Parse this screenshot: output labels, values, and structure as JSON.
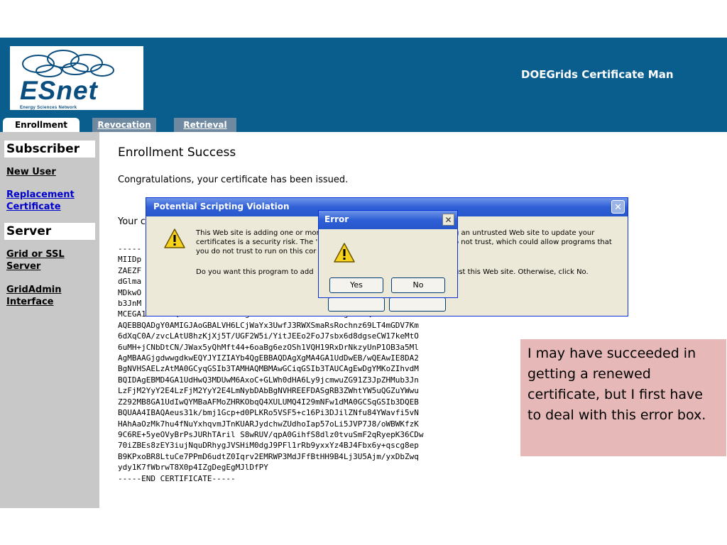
{
  "header": {
    "logo_word": "ESnet",
    "logo_subtitle": "Energy Sciences Network",
    "app_title": "DOEGrids Certificate Man"
  },
  "tabs": [
    {
      "label": "Enrollment"
    },
    {
      "label": "Revocation"
    },
    {
      "label": "Retrieval"
    }
  ],
  "sidebar": {
    "subscriber_heading": "Subscriber",
    "new_user": "New User",
    "replacement_1": "Replacement",
    "replacement_2": "Certificate",
    "server_heading": "Server",
    "grid_ssl_1": "Grid or SSL",
    "grid_ssl_2": "Server",
    "gridadmin_1": "GridAdmin",
    "gridadmin_2": "Interface"
  },
  "main": {
    "title": "Enrollment Success",
    "congrats": "Congratulations, your certificate has been issued.",
    "your_cert": "Your c",
    "cert_lines": [
      "-----",
      "MIIDp",
      "ZAEZF",
      "dGlma",
      "MDkwO",
      "b3JnM",
      "MCEGA1UEAxMaQWxhbiBBaGxlcnMgV2VobWFubiA0NDUxOTMwgZ8wDQYJKoZIhvcN",
      "AQEBBQADgY0AMIGJAoGBALVH6LCjWaYx3UwfJ3RWXSmaRsRochnz69LT4mGDV7Km",
      "6dXqC0A/zvcLAtU8hzKjXj5T/UGF2W5i/YitJEEo2FoJ7sbx6d8dgseCW17keMtO",
      "6uMH+jCNbDtCN/JWax5yQhMft44+6oaBg6ezOSh1VQH19RxDrNkzyUnP1OB3a5Ml",
      "AgMBAAGjgdwwgdkwEQYJYIZIAYb4QgEBBAQDAgXgMA4GA1UdDwEB/wQEAwIE8DA2",
      "BgNVHSAELzAtMA0GCyqGSIb3TAMHAQMBMAwGCiqGSIb3TAUCAgEwDgYMKoZIhvdM",
      "BQIDAgEBMD4GA1UdHwQ3MDUwM6AxoC+GLWh0dHA6Ly9jcmwuZG91Z3JpZHMub3Jn",
      "LzFjM2YyY2E4LzFjM2YyY2E4LmNybDAbBgNVHREEFDASgRB3ZWhtYW5uQGZuYWwu",
      "Z292MB8GA1UdIwQYMBaAFMoZHRKObqQ4XULUMQ4I29mNFw1dMA0GCSqGSIb3DQEB",
      "BQUAA4IBAQAeus31k/bmj1Gcp+d0PLKRo5VSF5+c16Pi3DJilZNfu84YWavfi5vN",
      "HAhAaOzMk7hu4fNuYxhqvmJTnKUARJydchwZUdhoIap57oLi5JVP7J8/oWBWKfzK",
      "9C6RE+5yeOVyBrPsJURhTAril S8wRUV/qpA0GihfS8dlz0tvuSmF2qRyepK36CDw",
      "70iZBEs8zEY3iujNquDRhygJVSHiM0dgJ9PFl1rRb9yxxYz4BJ4Fbx6y+qscg8ep",
      "B9KPxoBR8LtuCe7PPmD6udtZ0Iqrv2EMRWP3MdJFfBtHH9B4Lj3U5Ajm/yxDbZwq",
      "ydy1K7fWbrwT8X0p4IZgDegEgMJlDfPY",
      "-----END CERTIFICATE-----"
    ]
  },
  "dialog_psv": {
    "title": "Potential Scripting Violation",
    "close": "✕",
    "line1a": "This Web site is adding one or mor",
    "line1b": "g an untrusted Web site to update your",
    "line2a": "certificates is a security risk. The '",
    "line2b": "o not trust, which could allow programs that",
    "line3a": "you do not trust to run on this cor",
    "line4a": "Do you want this program to add",
    "line4b": "ust this Web site. Otherwise, click No."
  },
  "dialog_error": {
    "title": "Error",
    "close": "✕",
    "yes": "Yes",
    "no": "No"
  },
  "annotation": {
    "text": "I may have succeeded in getting a renewed certificate, but I first have to deal with this error box."
  },
  "colors": {
    "header_bg": "#0a5e8e",
    "sidebar_bg": "#c8c8c8",
    "dialog_bg": "#ece9d8",
    "titlebar_blue": "#2f5fd6",
    "annotation_bg": "#e6b9b8"
  }
}
